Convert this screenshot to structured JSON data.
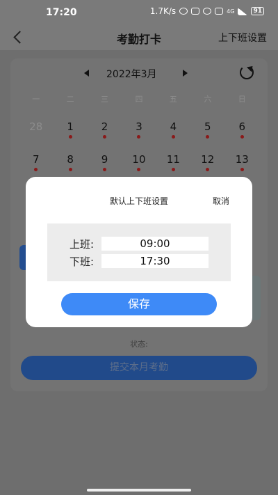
{
  "status_bar": {
    "time": "17:20",
    "net_speed": "1.7K/s",
    "signal_label": "4G",
    "battery": "91"
  },
  "nav": {
    "title": "考勤打卡",
    "right_action": "上下班设置"
  },
  "calendar": {
    "month_label": "2022年3月",
    "weekdays": [
      "一",
      "二",
      "三",
      "四",
      "五",
      "六",
      "日"
    ],
    "rows": [
      [
        {
          "day": "28",
          "muted": true,
          "dot": false
        },
        {
          "day": "1",
          "muted": false,
          "dot": true
        },
        {
          "day": "2",
          "muted": false,
          "dot": true
        },
        {
          "day": "3",
          "muted": false,
          "dot": true
        },
        {
          "day": "4",
          "muted": false,
          "dot": true
        },
        {
          "day": "5",
          "muted": false,
          "dot": true
        },
        {
          "day": "6",
          "muted": false,
          "dot": true
        }
      ],
      [
        {
          "day": "7",
          "muted": false,
          "dot": true
        },
        {
          "day": "8",
          "muted": false,
          "dot": true
        },
        {
          "day": "9",
          "muted": false,
          "dot": true
        },
        {
          "day": "10",
          "muted": false,
          "dot": true
        },
        {
          "day": "11",
          "muted": false,
          "dot": true
        },
        {
          "day": "12",
          "muted": false,
          "dot": true
        },
        {
          "day": "13",
          "muted": false,
          "dot": true
        }
      ]
    ]
  },
  "status_label": "状态:",
  "submit_label": "提交本月考勤",
  "modal": {
    "title": "默认上下班设置",
    "cancel_label": "取消",
    "on_duty_label": "上班:",
    "on_duty_time": "09:00",
    "off_duty_label": "下班:",
    "off_duty_time": "17:30",
    "save_label": "保存"
  },
  "colors": {
    "accent": "#3e8af7",
    "overlay": "#737373",
    "dot": "#8a1a1a"
  }
}
